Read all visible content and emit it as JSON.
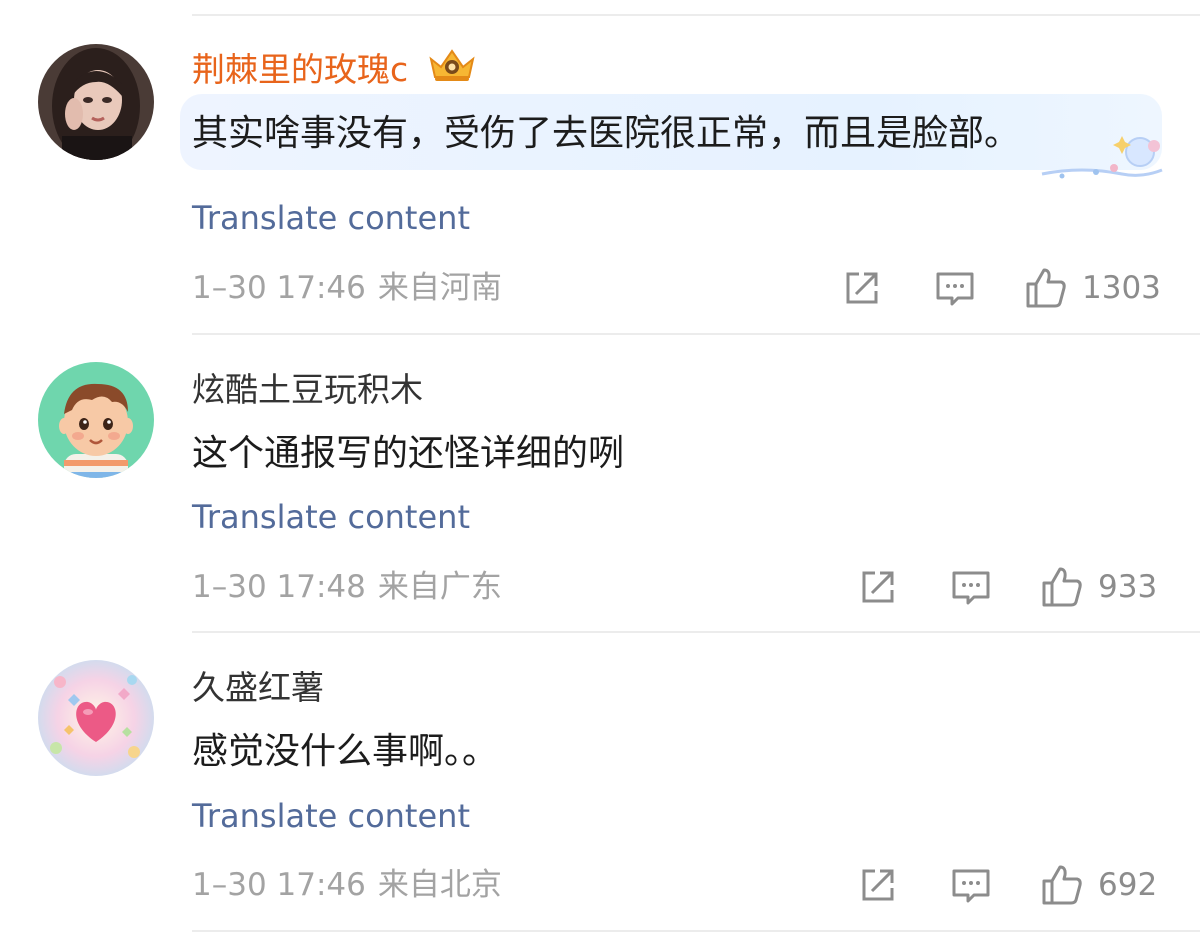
{
  "comments": [
    {
      "username": "荆棘里的玫瑰c",
      "vip": true,
      "avatar": "avatar-girl",
      "content": "其实啥事没有，受伤了去医院很正常，而且是脸部。",
      "translate": "Translate content",
      "date": "1–30 17:46",
      "source": "来自河南",
      "likes": "1303",
      "icons": [
        "share-icon",
        "comment-icon",
        "like-icon"
      ]
    },
    {
      "username": "炫酷土豆玩积木",
      "vip": false,
      "avatar": "avatar-cartoon-boy",
      "content": "这个通报写的还怪详细的咧",
      "translate": "Translate content",
      "date": "1–30 17:48",
      "source": "来自广东",
      "likes": "933",
      "icons": [
        "share-icon",
        "comment-icon",
        "like-icon"
      ]
    },
    {
      "username": "久盛红薯",
      "vip": false,
      "avatar": "avatar-heart-butterflies",
      "content": "感觉没什么事啊。。",
      "translate": "Translate content",
      "date": "1–30 17:46",
      "source": "来自北京",
      "likes": "692",
      "icons": [
        "share-icon",
        "comment-icon",
        "like-icon"
      ]
    }
  ],
  "colors": {
    "vip_name": "#e8641b",
    "name": "#333333",
    "text": "#1c1c1c",
    "translate_link": "#536b9a",
    "meta": "#a3a3a3",
    "icon": "#8c8c8c"
  }
}
